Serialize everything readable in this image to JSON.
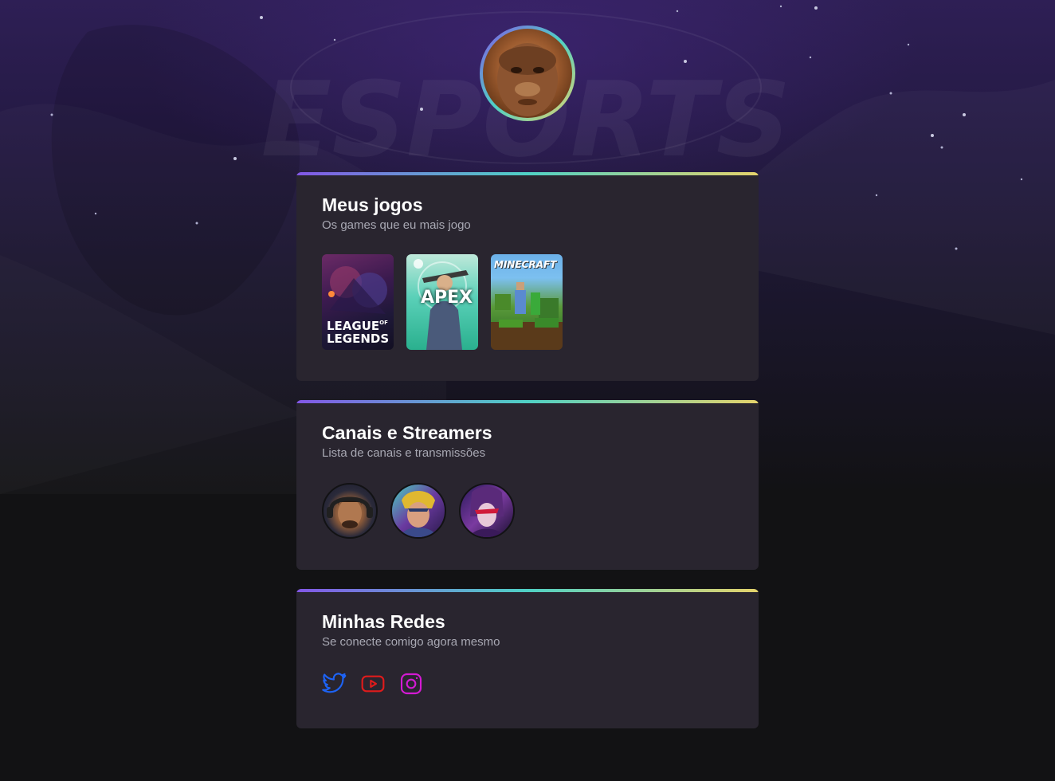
{
  "profile": {
    "avatar_alt": "avatar"
  },
  "sections": [
    {
      "title": "Meus jogos",
      "subtitle": "Os games que eu mais jogo",
      "games": [
        {
          "name": "LEAGUE",
          "name2": "LEGENDS",
          "of": "OF"
        },
        {
          "name": "APEX"
        },
        {
          "name": "MINECRAFT"
        }
      ]
    },
    {
      "title": "Canais e Streamers",
      "subtitle": "Lista de canais e transmissões"
    },
    {
      "title": "Minhas Redes",
      "subtitle": "Se conecte comigo agora mesmo",
      "socials": [
        {
          "icon": "twitter-icon",
          "color": "#1d63f5"
        },
        {
          "icon": "youtube-icon",
          "color": "#e01b1b"
        },
        {
          "icon": "instagram-icon",
          "color": "#d41ad4"
        }
      ]
    }
  ]
}
